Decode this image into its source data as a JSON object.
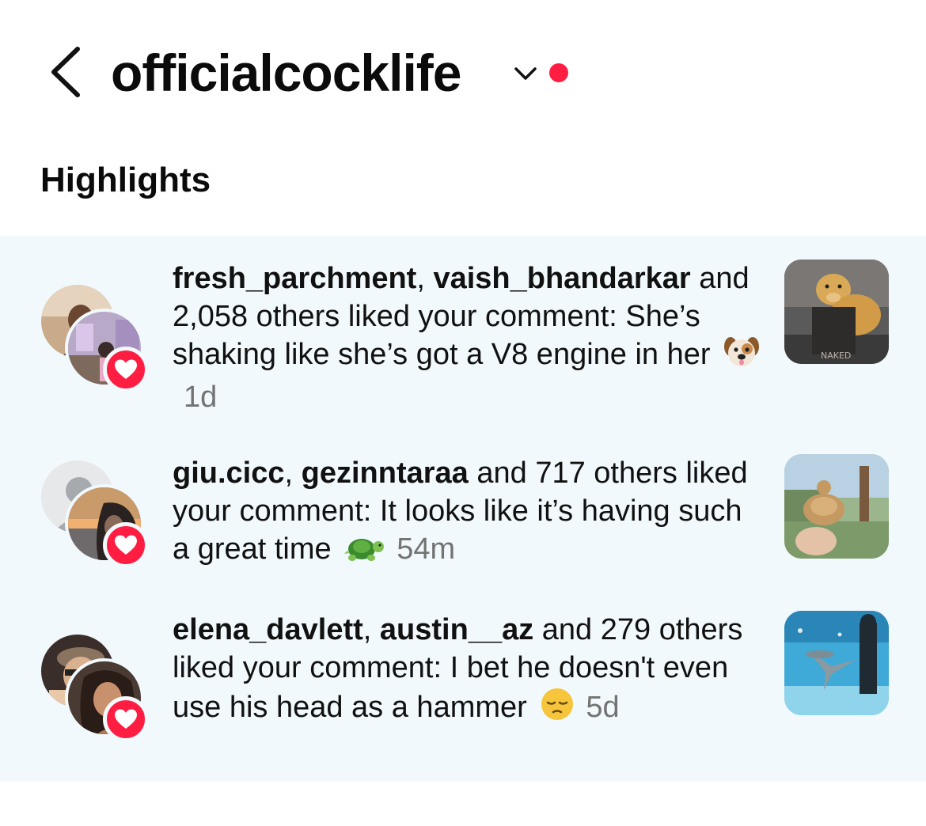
{
  "header": {
    "username": "officialcocklife",
    "back_icon": "chevron-left-icon",
    "switcher_icon": "chevron-down-icon",
    "notification_dot_color": "#ff1d42"
  },
  "section_title": "Highlights",
  "notifications": [
    {
      "user1": "fresh_parchment",
      "sep": ", ",
      "user2": "vaish_bhandarkar",
      "message": " and 2,058 others liked your comment: She’s shaking like she’s got a V8 engine in her",
      "emoji": "dog-face",
      "time": "1d"
    },
    {
      "user1": "giu.cicc",
      "sep": ", ",
      "user2": "gezinntaraa",
      "message": " and 717 others liked your comment: It looks like it’s having such a great time",
      "emoji": "turtle",
      "time": "54m"
    },
    {
      "user1": "elena_davlett",
      "sep": ", ",
      "user2": "austin__az",
      "message": " and 279 others liked your comment: I bet he doesn't even use his head as a hammer",
      "emoji": "pensive-face",
      "time": "5d"
    }
  ],
  "colors": {
    "highlight_bg": "#f1f9fc",
    "heart_badge": "#ff1d42",
    "timestamp": "#737373"
  }
}
